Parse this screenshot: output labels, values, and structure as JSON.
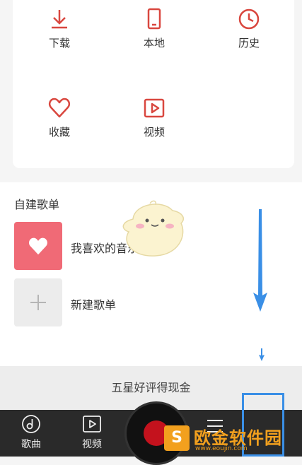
{
  "quick_access": {
    "items": [
      {
        "label": "下载",
        "icon": "download-icon"
      },
      {
        "label": "本地",
        "icon": "phone-icon"
      },
      {
        "label": "历史",
        "icon": "clock-icon"
      },
      {
        "label": "收藏",
        "icon": "heart-icon"
      },
      {
        "label": "视频",
        "icon": "video-icon"
      }
    ]
  },
  "playlists": {
    "title": "自建歌单",
    "items": [
      {
        "name": "我喜欢的音乐",
        "cover_color": "#f06a76"
      },
      {
        "name": "新建歌单",
        "cover_color": "#ececec"
      }
    ]
  },
  "promo": {
    "text": "五星好评得现金"
  },
  "tabbar": {
    "items": [
      {
        "label": "歌曲",
        "icon": "music-note-icon"
      },
      {
        "label": "视频",
        "icon": "video-icon"
      }
    ]
  },
  "watermark": {
    "logo": "S",
    "text": "欧金软件园",
    "url": "www.eoujin.com"
  },
  "colors": {
    "accent": "#d9473f",
    "highlight": "#3a8fe6",
    "arrow": "#3a8fe6"
  }
}
